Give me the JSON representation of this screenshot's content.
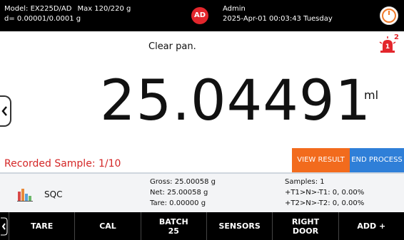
{
  "header": {
    "model": "Model: EX225D/AD",
    "max": "Max 120/220 g",
    "division": "d= 0.00001/0.0001 g",
    "avatar_initials": "AD",
    "user_name": "Admin",
    "datetime": "2025-Apr-01 00:03:43 Tuesday"
  },
  "status": {
    "message": "Clear pan.",
    "alarm_count": "2"
  },
  "reading": {
    "value": "25.04491",
    "unit": "ml"
  },
  "process": {
    "recorded_sample": "Recorded Sample: 1/10",
    "view_result_label": "VIEW RESULT",
    "end_process_label": "END PROCESS"
  },
  "info": {
    "mode_label": "SQC",
    "gross": "Gross: 25.00058 g",
    "net": "Net: 25.00058 g",
    "tare": "Tare: 0.00000 g",
    "samples": "Samples: 1",
    "t1": "+T1>N>-T1: 0, 0.00%",
    "t2": "+T2>N>-T2: 0, 0.00%"
  },
  "toolbar": {
    "tare": "TARE",
    "cal": "CAL",
    "batch_line1": "BATCH",
    "batch_line2": "25",
    "sensors": "SENSORS",
    "right_door_line1": "RIGHT",
    "right_door_line2": "DOOR",
    "add": "ADD +"
  },
  "colors": {
    "accent_red": "#e3262c",
    "view_result_bg": "#f26b1d",
    "end_process_bg": "#2f7fd8"
  }
}
